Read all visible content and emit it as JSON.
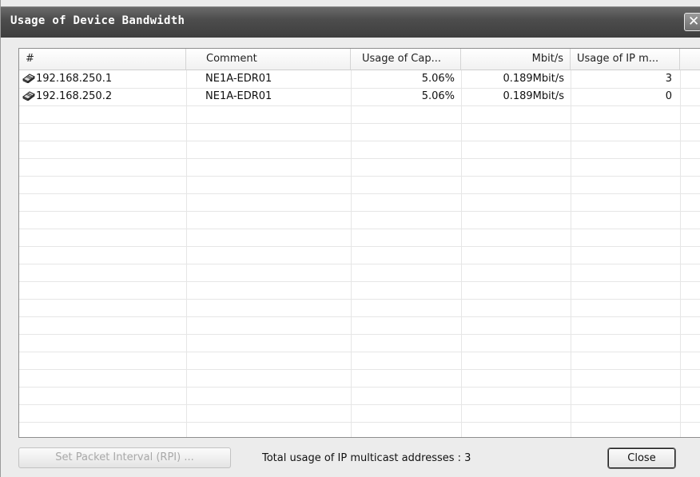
{
  "window": {
    "title": "Usage of Device Bandwidth",
    "close_glyph": "✕"
  },
  "table": {
    "columns": [
      "#",
      "Comment",
      "Usage of Cap...",
      "Mbit/s",
      "Usage of IP m..."
    ],
    "rows": [
      {
        "device": "192.168.250.1",
        "comment": "NE1A-EDR01",
        "usage_cap": "5.06%",
        "mbit": "0.189Mbit/s",
        "ip_multicast": "3",
        "icon": "network-device-icon"
      },
      {
        "device": "192.168.250.2",
        "comment": "NE1A-EDR01",
        "usage_cap": "5.06%",
        "mbit": "0.189Mbit/s",
        "ip_multicast": "0",
        "icon": "network-device-icon"
      }
    ]
  },
  "footer": {
    "set_rpi_label": "Set Packet Interval (RPI) ...",
    "total_text": "Total usage of IP multicast addresses : 3",
    "close_label": "Close"
  }
}
